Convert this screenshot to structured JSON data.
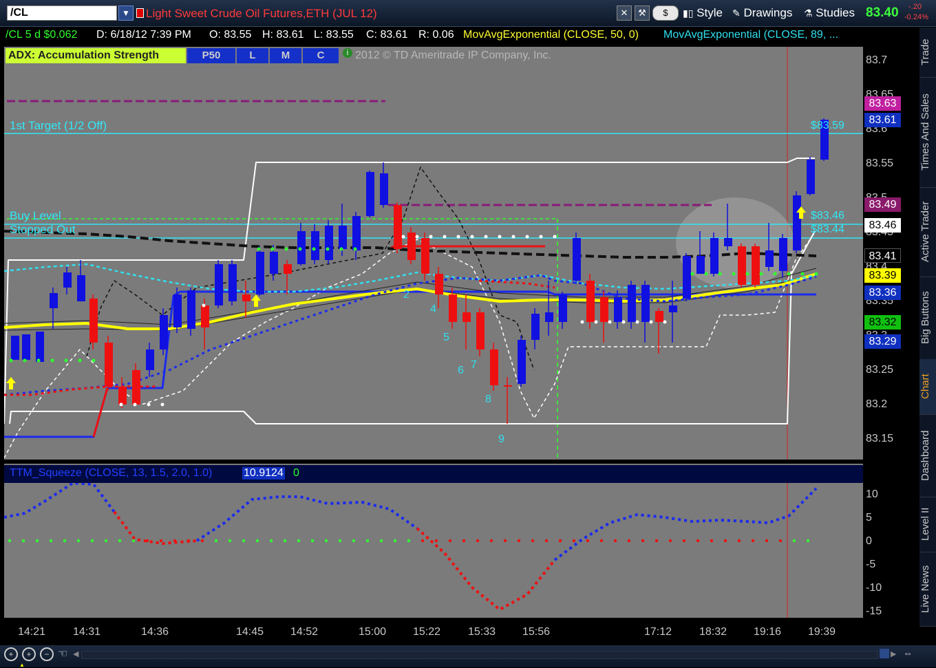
{
  "toolbar": {
    "symbol": "/CL",
    "dropdown_arrow": "▼",
    "title": "Light Sweet Crude Oil Futures,ETH (JUL 12)",
    "dollar": "$",
    "style_label": "Style",
    "drawings_label": "Drawings",
    "studies_label": "Studies",
    "last_price": "83.40",
    "change": "-.20",
    "change_pct": "-0.24%"
  },
  "infobar": {
    "series": "/CL 5 d $0.062",
    "date": "D: 6/18/12 7:39 PM",
    "open": "O: 83.55",
    "high": "H: 83.61",
    "low": "L: 83.55",
    "close": "C: 83.61",
    "range": "R: 0.06",
    "study1": "MovAvgExponential (CLOSE, 50, 0)",
    "study2": "MovAvgExponential (CLOSE, 89, ..."
  },
  "adx": {
    "label": "ADX:  Accumulation Strength",
    "buttons": [
      "P50",
      "L",
      "M",
      "C"
    ],
    "copyright": "2012 © TD Ameritrade IP Company, Inc."
  },
  "chart_labels": {
    "first_target": "1st Target (1/2 Off)",
    "buy_level": "Buy Level",
    "stopped_out": "Stopped Out",
    "price_59": "$83.59",
    "price_46": "$83.46",
    "price_44": "$83.44",
    "wave_counts": [
      "2",
      "4",
      "5",
      "6",
      "7",
      "8",
      "9"
    ]
  },
  "price_axis": [
    "83.7",
    "83.65",
    "83.6",
    "83.55",
    "83.5",
    "83.45",
    "83.4",
    "83.35",
    "83.3",
    "83.25",
    "83.2",
    "83.15"
  ],
  "price_badges": [
    {
      "text": "83.63",
      "bg": "#c020a0",
      "fg": "#ffffff"
    },
    {
      "text": "83.61",
      "bg": "#1030c0",
      "fg": "#ffffff"
    },
    {
      "text": "83.49",
      "bg": "#8a1a6a",
      "fg": "#ffffff"
    },
    {
      "text": "83.46",
      "bg": "#ffffff",
      "fg": "#000000"
    },
    {
      "text": "83.41",
      "bg": "#000000",
      "fg": "#ffffff"
    },
    {
      "text": "83.39",
      "bg": "#ffff00",
      "fg": "#000000"
    },
    {
      "text": "83.36",
      "bg": "#1030c0",
      "fg": "#ffffff"
    },
    {
      "text": "83.32",
      "bg": "#10c010",
      "fg": "#000000"
    },
    {
      "text": "83.29",
      "bg": "#1030c0",
      "fg": "#ffffff"
    }
  ],
  "squeeze": {
    "label": "TTM_Squeeze (CLOSE, 13, 1.5, 2.0, 1.0)",
    "value": "10.9124",
    "zero": "0"
  },
  "lower_axis": [
    "10",
    "5",
    "0",
    "-5",
    "-10",
    "-15"
  ],
  "time_axis": [
    "14:21",
    "14:31",
    "14:36",
    "14:45",
    "14:52",
    "15:00",
    "15:22",
    "15:33",
    "15:56",
    "17:12",
    "18:32",
    "19:16",
    "19:39"
  ],
  "sidebar": [
    "Trade",
    "Times And Sales",
    "Active Trader",
    "Big Buttons",
    "Chart",
    "Dashboard",
    "Level II",
    "Live News"
  ],
  "colors": {
    "bull": "#1010e0",
    "bear": "#ee1010",
    "cyan": "#30e0f0",
    "chart_bg": "#7b7b7b"
  }
}
